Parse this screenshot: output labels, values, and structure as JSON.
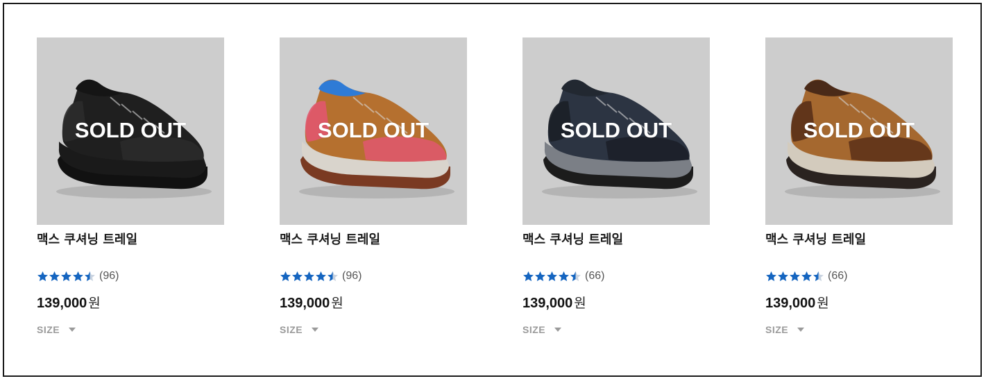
{
  "colors": {
    "star": "#1565c0",
    "image_bg": "#cdcdcd",
    "sold_out_text": "#ffffff",
    "size_label": "#9a9a9a"
  },
  "products": [
    {
      "image": "black-trail-shoe",
      "overlay": "SOLD OUT",
      "name": "맥스 쿠셔닝 트레일",
      "rating": 4.5,
      "review_count": "(96)",
      "price": "139,000",
      "currency": "원",
      "size_label": "SIZE",
      "palette": {
        "upper": "#1f1f1f",
        "accent": "#2b2b2b",
        "midsole": "#1a1a1a",
        "outsole": "#111111",
        "collar": "#151515"
      }
    },
    {
      "image": "tan-pink-trail-shoe",
      "overlay": "SOLD OUT",
      "name": "맥스 쿠셔닝 트레일",
      "rating": 4.5,
      "review_count": "(96)",
      "price": "139,000",
      "currency": "원",
      "size_label": "SIZE",
      "palette": {
        "upper": "#b5702f",
        "accent": "#e1576e",
        "midsole": "#d9d4cc",
        "outsole": "#7a3a22",
        "collar": "#2f7bd6"
      }
    },
    {
      "image": "navy-grey-trail-shoe",
      "overlay": "SOLD OUT",
      "name": "맥스 쿠셔닝 트레일",
      "rating": 4.5,
      "review_count": "(66)",
      "price": "139,000",
      "currency": "원",
      "size_label": "SIZE",
      "palette": {
        "upper": "#2c3442",
        "accent": "#1b1f27",
        "midsole": "#7b7f86",
        "outsole": "#1c1c1c",
        "collar": "#222831"
      }
    },
    {
      "image": "brown-trail-shoe",
      "overlay": "SOLD OUT",
      "name": "맥스 쿠셔닝 트레일",
      "rating": 4.5,
      "review_count": "(66)",
      "price": "139,000",
      "currency": "원",
      "size_label": "SIZE",
      "palette": {
        "upper": "#a5682f",
        "accent": "#5a3018",
        "midsole": "#d3cbbd",
        "outsole": "#2a2320",
        "collar": "#4a2a18"
      }
    }
  ]
}
